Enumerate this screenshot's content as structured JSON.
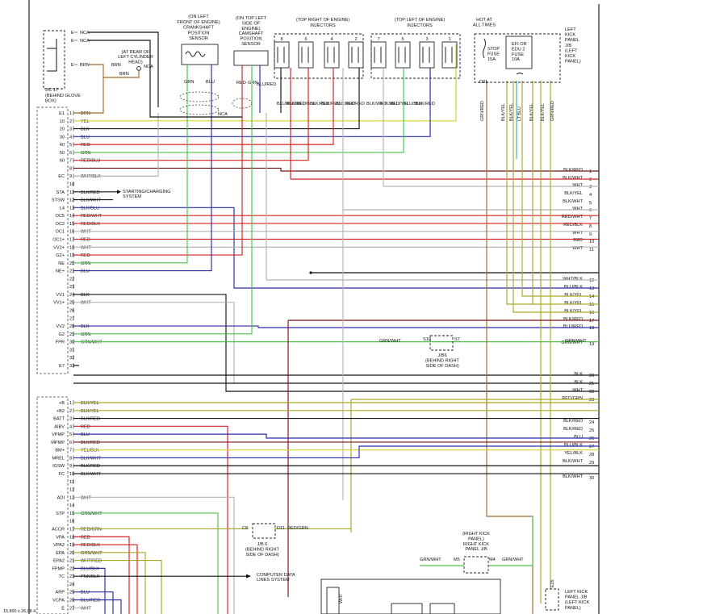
{
  "components": {
    "j17": [
      "J/C 17",
      "(BEHIND GLOVE",
      "BOX)"
    ],
    "j17_pins": [
      "E",
      "E",
      "E"
    ],
    "j17_wires": [
      "NCA",
      "NCA",
      "BRN"
    ],
    "knock_note": [
      "(AT REAR OF",
      "LEFT CYLINDER",
      "HEAD)"
    ],
    "knock_wires": [
      "BRN",
      "BRN",
      "NCA"
    ],
    "crank": [
      "(ON LEFT",
      "FRONT OF ENGINE)",
      "CRANKSHAFT",
      "POSITION",
      "SENSOR"
    ],
    "cam": [
      "(ON TOP LEFT",
      "SIDE OF",
      "ENGINE)",
      "CAMSHAFT",
      "POSITION",
      "SENSOR"
    ],
    "inj_right": [
      "(TOP RIGHT OF ENGINE)",
      "INJECTORS"
    ],
    "inj_left": [
      "(TOP LEFT OF ENGINE)",
      "INJECTORS"
    ],
    "injector_nums": [
      "8",
      "6",
      "4",
      "2",
      "7",
      "5",
      "3",
      "1"
    ],
    "hot": [
      "HOT AT",
      "ALL TIMES"
    ],
    "stop_fuse": [
      "STOP",
      "FUSE",
      "15A"
    ],
    "efi_fuse": [
      "EFI OR",
      "EDU 2",
      "FUSE",
      "10A"
    ],
    "kick": [
      "LEFT",
      "KICK",
      "PANEL",
      "J/B",
      "(LEFT",
      "KICK",
      "PANEL)"
    ],
    "j6a": [
      "J/B6",
      "(BEHIND RIGHT",
      "SIDE OF DASH)"
    ],
    "j6b": [
      "J/B 6",
      "(BEHIND RIGHT",
      "SIDE OF DASH)"
    ],
    "rkick": [
      "(RIGHT KICK",
      "PANEL)",
      "RIGHT KICK",
      "PANEL J/B"
    ],
    "lkick_bottom": [
      "LEFT KICK",
      "PANEL J/B",
      "(LEFT KICK",
      "PANEL)"
    ],
    "starting": [
      "STARTING/CHARGING",
      "SYSTEM"
    ],
    "computer": [
      "COMPUTER DATA",
      "LINES SYSTEM"
    ],
    "conn_labels": [
      "NCA",
      "NCA",
      "GRN/RED",
      "D31",
      "S10",
      "S7",
      "C8",
      "D11",
      "M5",
      "M4",
      "E25"
    ]
  },
  "ecu_a": {
    "terms": [
      "E1",
      "10",
      "20",
      "30",
      "40",
      "50",
      "60",
      "",
      "EC",
      "",
      "STA",
      "STSW",
      "L4",
      "OC5",
      "OC2",
      "OC1",
      "OC1+",
      "VV2+",
      "G2+",
      "NE",
      "NE+",
      "",
      "",
      "VV1",
      "VV1+",
      "",
      "",
      "VV2",
      "G2",
      "FPR",
      "",
      "",
      "E7"
    ],
    "wires": [
      "BRN",
      "YEL",
      "BLK",
      "BLU",
      "RED",
      "GRN",
      "RED/BLU",
      "",
      "WHT/BLK",
      "",
      "BLK/RED",
      "BLK/WHT",
      "BLK/BLU",
      "RED/WHT",
      "RED/BLK",
      "WHT",
      "RED",
      "WHT",
      "RED",
      "GRN",
      "BLU",
      "",
      "",
      "BLK",
      "WHT",
      "",
      "",
      "BLK",
      "GRN",
      "GRN/WHT",
      "",
      "",
      ""
    ]
  },
  "ecu_b": {
    "terms": [
      "+B",
      "+B2",
      "BATT",
      "AIBV",
      "VPMP",
      "MPMP",
      "BM+",
      "MREL",
      "IGSW",
      "FC",
      "",
      "",
      "ADI",
      "",
      "STP",
      "",
      "ACCR",
      "VPA",
      "VPA2",
      "EPA",
      "EPA2",
      "FPMP",
      "TC",
      "",
      "ARP",
      "VCPA",
      "E"
    ],
    "wires": [
      "BLK/YEL",
      "BLK/YEL",
      "BLK/RED",
      "RED",
      "BLU",
      "BLK/RED",
      "YEL/BLK",
      "BLK/WHT",
      "BLK/RED",
      "BLK/WHT",
      "",
      "",
      "WHT",
      "",
      "GRN/WHT",
      "",
      "RED/GRN",
      "RED",
      "RED/BLK",
      "GRN/WHT",
      "WHT/RED",
      "BLU/BLK",
      "PNK/BLK",
      "",
      "BLU",
      "BLU/RED",
      "WHT"
    ]
  },
  "right_a": {
    "nums": [
      "1",
      "2",
      "3",
      "4",
      "5",
      "6",
      "7",
      "8",
      "9",
      "10",
      "11",
      "12",
      "13",
      "14",
      "15",
      "16",
      "17",
      "18",
      "19",
      "20",
      "21",
      "22",
      "23"
    ],
    "labels": [
      "BLK/RED",
      "BLK/WHT",
      "WHT",
      "BLK/YEL",
      "BLK/WHT",
      "WHT",
      "RED/WHT",
      "RED/BLK",
      "WHT",
      "RED",
      "WHT",
      "WHT/BLK",
      "BLU/BLK",
      "BLK/YEL",
      "BLK/YEL",
      "BLK/YEL",
      "BLK/RED",
      "BLU/RED",
      "GRN/WHT",
      "BLK",
      "BLK",
      "WHT",
      "RED/GRN"
    ]
  },
  "right_b": {
    "nums": [
      "24",
      "25",
      "26",
      "27",
      "28",
      "29",
      "30"
    ],
    "labels": [
      "BLK/RED",
      "BLK/RED",
      "BLU",
      "BLU/BLK",
      "YEL/BLK",
      "BLK/WHT",
      "BLK/WHT"
    ]
  },
  "injector_wires": [
    "BLU/RED",
    "BLK/RED",
    "BLU/BLK",
    "BLK/RED",
    "BLK/RED",
    "BLK/RED",
    "BLK/RED",
    "BLK/WHT",
    "BLK/RED",
    "BLU/YEL",
    "BLU/BLK",
    "BLK/RED"
  ],
  "right_fuse_wires": [
    "BLK/YEL",
    "BLK/YEL",
    "LT BLU",
    "BLK/YEL",
    "BLK/YEL",
    "GRN/RED"
  ],
  "mid_labels": [
    "BLU/RED",
    "GRN/WHT",
    "GRN/WHT",
    "RED/GRN",
    "GRN/WHT",
    "GRN/WHT",
    "BLU/YEL",
    "WHT"
  ],
  "colors": {
    "red": "#d42020",
    "blue": "#2a2aa8",
    "green": "#4cc24c",
    "yellow": "#d8d030",
    "gray": "#b4b4b4",
    "olive": "#a8a828",
    "brown": "#a46a2c",
    "black": "#111111",
    "cyan": "#40a8c8",
    "wine": "#7a1414"
  },
  "footer": "15,800 x 26,08 4"
}
